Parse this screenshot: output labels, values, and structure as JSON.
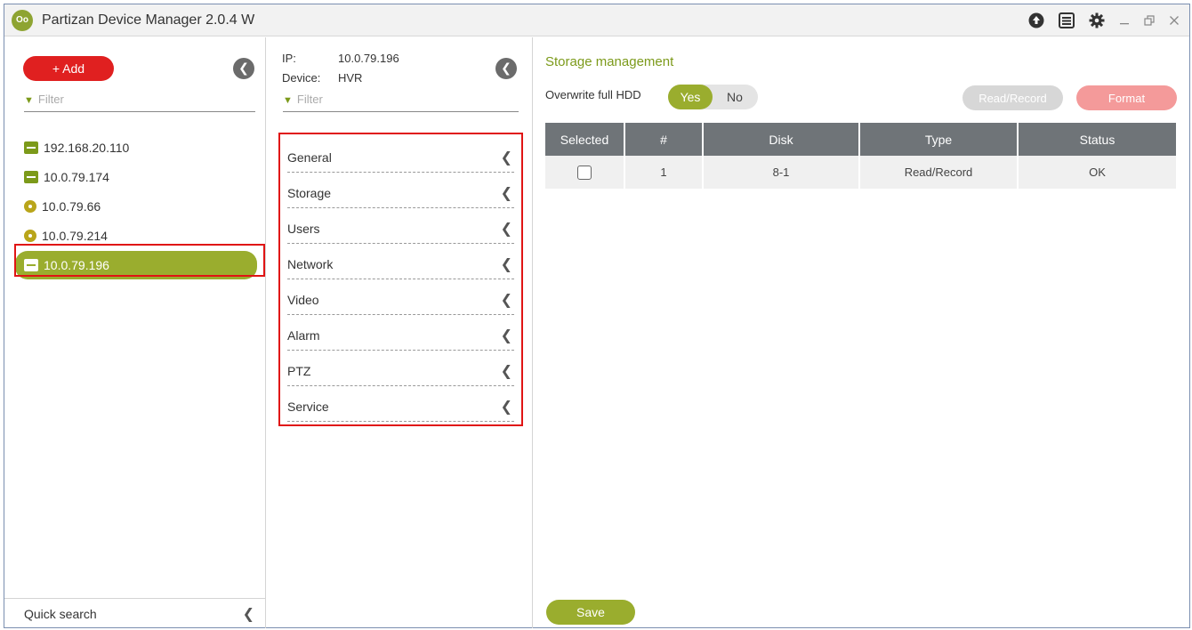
{
  "window": {
    "title": "Partizan Device Manager 2.0.4 W",
    "logo_text": "Oo"
  },
  "titlebar_icons": [
    "upload-icon",
    "list-icon",
    "gear-icon",
    "minimize-icon",
    "restore-icon",
    "close-icon"
  ],
  "left": {
    "add_label": "+ Add",
    "filter_placeholder": "Filter",
    "devices": [
      {
        "label": "192.168.20.110",
        "icon": "network-device-icon"
      },
      {
        "label": "10.0.79.174",
        "icon": "recorder-icon"
      },
      {
        "label": "10.0.79.66",
        "icon": "camera-icon"
      },
      {
        "label": "10.0.79.214",
        "icon": "camera-icon"
      },
      {
        "label": "10.0.79.196",
        "icon": "recorder-icon",
        "selected": true
      }
    ],
    "quick_search": "Quick search"
  },
  "middle": {
    "ip_label": "IP:",
    "ip_value": "10.0.79.196",
    "device_label": "Device:",
    "device_value": "HVR",
    "filter_placeholder": "Filter",
    "menu": [
      "General",
      "Storage",
      "Users",
      "Network",
      "Video",
      "Alarm",
      "PTZ",
      "Service"
    ]
  },
  "right": {
    "title": "Storage management",
    "overwrite_label": "Overwrite full HDD",
    "toggle_yes": "Yes",
    "toggle_no": "No",
    "overwrite_selected": "Yes",
    "read_record_button": "Read/Record",
    "format_button": "Format",
    "table": {
      "headers": [
        "Selected",
        "#",
        "Disk",
        "Type",
        "Status"
      ],
      "rows": [
        {
          "selected": false,
          "num": "1",
          "disk": "8-1",
          "type": "Read/Record",
          "status": "OK"
        }
      ]
    },
    "save_button": "Save"
  },
  "colors": {
    "accent": "#9aad2e",
    "add_button": "#e02020",
    "highlight_border": "#e01414",
    "table_header": "#6f7478"
  }
}
